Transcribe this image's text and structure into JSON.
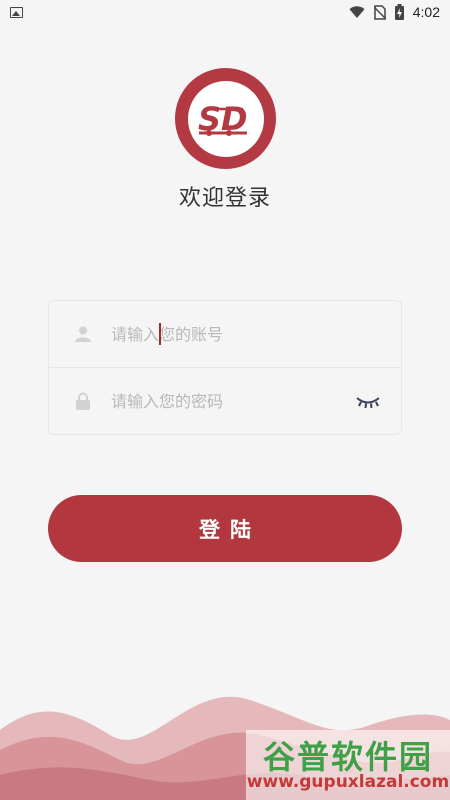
{
  "status_bar": {
    "time": "4:02",
    "icons": [
      "gallery-icon",
      "wifi-icon",
      "no-sim-icon",
      "battery-charging-icon"
    ]
  },
  "logo": {
    "text": "SD",
    "color": "#b33a43"
  },
  "welcome_text": "欢迎登录",
  "form": {
    "account": {
      "placeholder": "请输入您的账号",
      "value": "",
      "icon": "user-icon"
    },
    "password": {
      "placeholder": "请输入您的密码",
      "value": "",
      "icon": "lock-icon",
      "toggle_icon": "eye-closed-icon"
    }
  },
  "login_button": {
    "label": "登陆",
    "color": "#b3373f"
  },
  "watermark": {
    "title": "谷普软件园",
    "url": "www.gupuxlazal.com"
  },
  "colors": {
    "accent": "#b3373f",
    "background": "#f5f5f5",
    "wave_light": "#e5b8bc",
    "wave_dark": "#c97a80"
  }
}
